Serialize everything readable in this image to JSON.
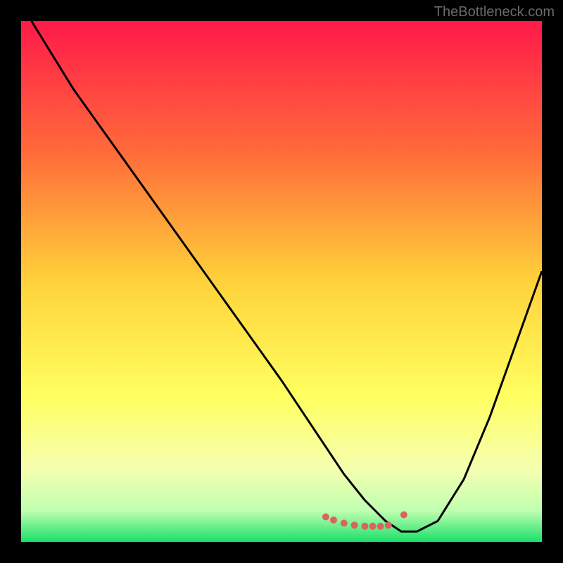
{
  "watermark": "TheBottleneck.com",
  "chart_data": {
    "type": "line",
    "title": "",
    "xlabel": "",
    "ylabel": "",
    "xlim": [
      0,
      100
    ],
    "ylim": [
      0,
      100
    ],
    "background_gradient": {
      "stops": [
        {
          "offset": 0,
          "color": "#ff1a4a"
        },
        {
          "offset": 25,
          "color": "#ff6a3a"
        },
        {
          "offset": 50,
          "color": "#ffd23a"
        },
        {
          "offset": 72,
          "color": "#ffff60"
        },
        {
          "offset": 86,
          "color": "#f5ffb0"
        },
        {
          "offset": 94,
          "color": "#c0ffb0"
        },
        {
          "offset": 100,
          "color": "#1adf6a"
        }
      ]
    },
    "series": [
      {
        "name": "bottleneck-curve",
        "color": "#000000",
        "x": [
          2,
          10,
          20,
          30,
          40,
          50,
          58,
          62,
          66,
          70,
          73,
          76,
          80,
          85,
          90,
          95,
          100
        ],
        "y": [
          100,
          87,
          73,
          59,
          45,
          31,
          19,
          13,
          8,
          4,
          2,
          2,
          4,
          12,
          24,
          38,
          52
        ]
      }
    ],
    "markers": {
      "name": "highlight-dots",
      "color": "#d9645f",
      "radius": 5,
      "x": [
        58.5,
        60,
        62,
        64,
        66,
        67.5,
        69,
        70.5,
        73.5
      ],
      "y": [
        4.8,
        4.2,
        3.6,
        3.2,
        3.0,
        3.0,
        3.0,
        3.2,
        5.2
      ]
    }
  }
}
